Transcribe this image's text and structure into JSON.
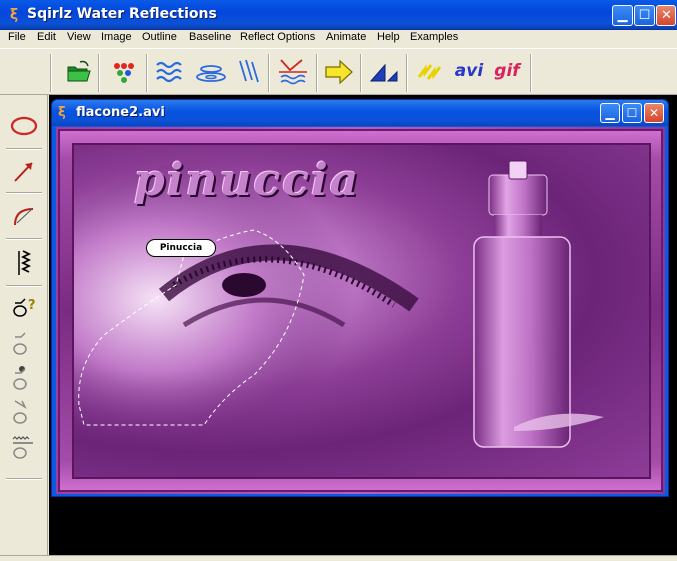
{
  "window": {
    "title": "Sqirlz Water Reflections",
    "icon": "squirrel-icon"
  },
  "menu": {
    "items": [
      "File",
      "Edit",
      "View",
      "Image",
      "Outline",
      "Baseline",
      "Reflect Options",
      "Animate",
      "Help",
      "Examples"
    ]
  },
  "toolbar": {
    "buttons": [
      {
        "icon": "open-folder-icon"
      },
      {
        "icon": "color-dots-icon"
      },
      {
        "icon": "water-waves-icon"
      },
      {
        "icon": "ripples-icon"
      },
      {
        "icon": "rain-lines-icon"
      },
      {
        "icon": "reflect-baseline-icon"
      },
      {
        "icon": "arrow-right-icon"
      },
      {
        "icon": "perspective-icon"
      },
      {
        "icon": "lightning-icon"
      },
      {
        "label": "avi"
      },
      {
        "label": "gif"
      }
    ]
  },
  "toolbox": {
    "tools": [
      "ellipse-tool-icon",
      "arrow-tool-icon",
      "curve-tool-icon",
      "zigzag-tool-icon",
      "help-shape-tool-icon",
      "baseline-tool-icon",
      "fill-tool-icon",
      "flip-tool-icon",
      "waves-tool-icon"
    ]
  },
  "document": {
    "title": "flacone2.avi",
    "image_text": "pinuccia",
    "badge_text": "Pinuccia"
  },
  "colors": {
    "titlebar": "#0a52d8",
    "accent_purple": "#9b3fa0",
    "close_red": "#d6452c"
  }
}
